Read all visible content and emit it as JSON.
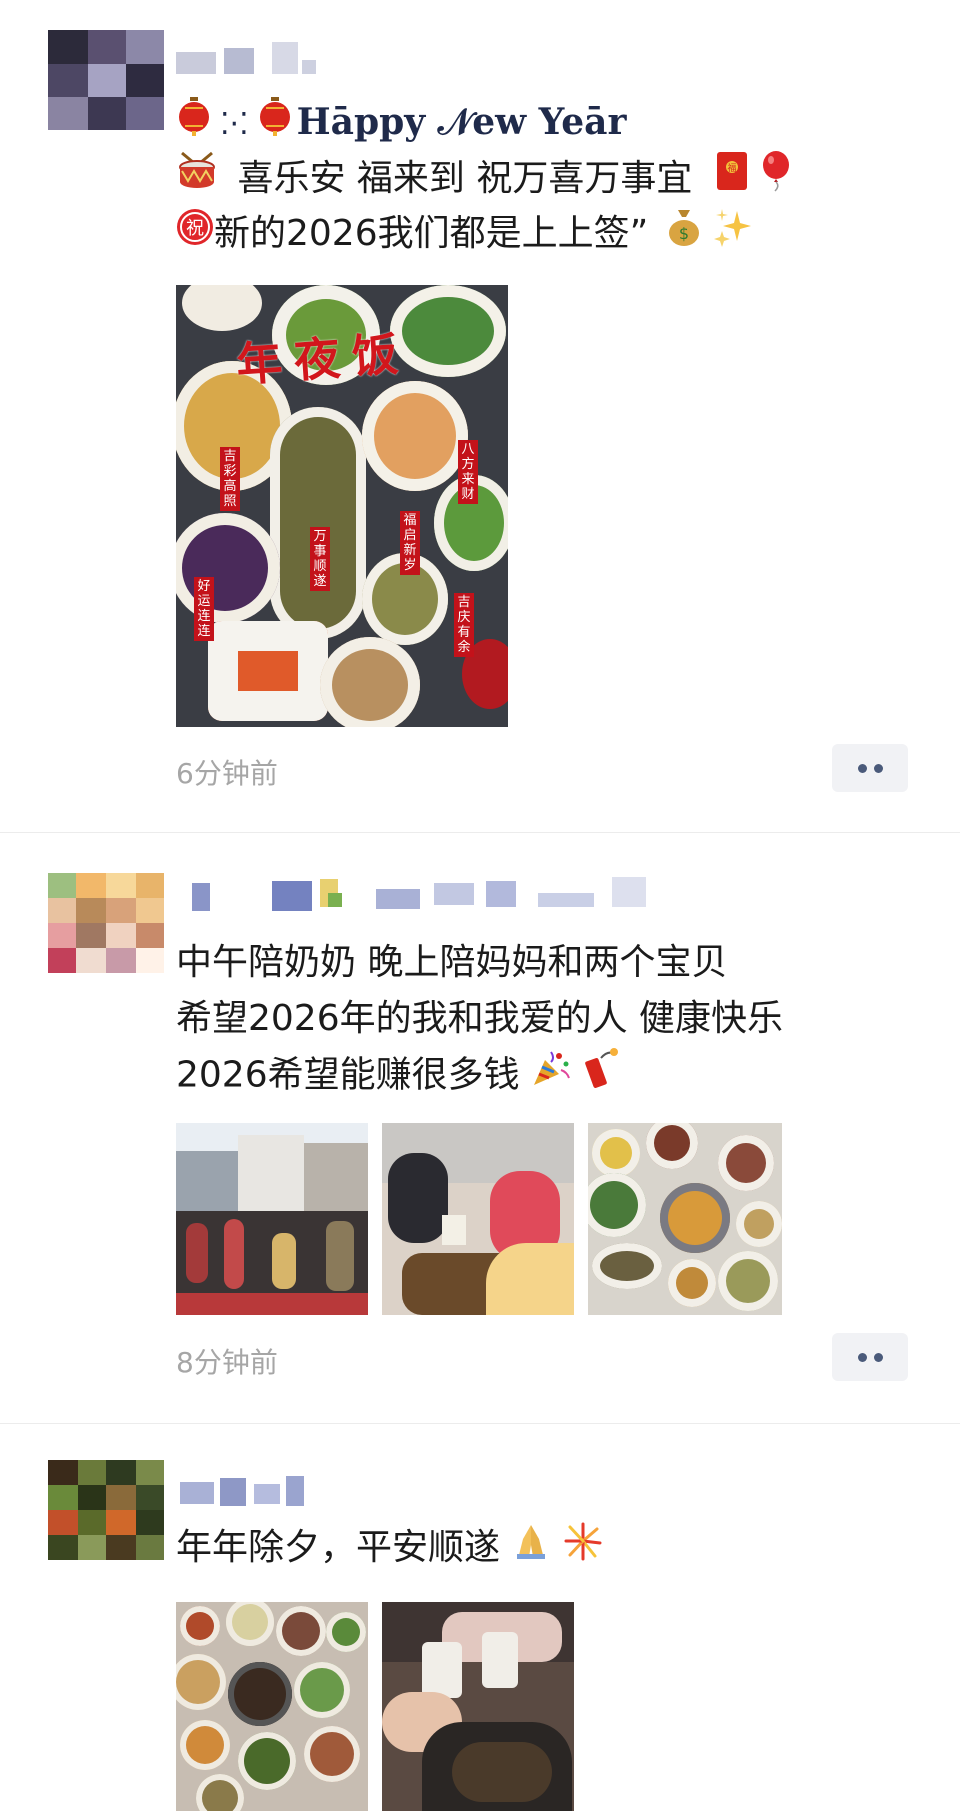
{
  "posts": [
    {
      "line1": {
        "text": "Hāppy 𝒩ew Yeār"
      },
      "line2": "喜乐安 福来到 祝万喜万事宜",
      "line3": "新的2026我们都是上上签”",
      "image_title": "年夜饭",
      "image_tags": [
        "吉彩高照",
        "八方来财",
        "福启新岁",
        "万事顺遂",
        "吉庆有余",
        "好运连连"
      ],
      "time": "6分钟前",
      "icons": [
        "lantern-icon",
        "drum-icon",
        "red-envelope-icon",
        "balloon-icon",
        "blessing-icon",
        "money-bag-icon",
        "sparkles-icon"
      ]
    },
    {
      "line1": "中午陪奶奶 晚上陪妈妈和两个宝贝",
      "line2": "希望2026年的我和我爱的人 健康快乐",
      "line3": "2026希望能赚很多钱",
      "time": "8分钟前",
      "icons": [
        "party-popper-icon",
        "firecracker-icon"
      ]
    },
    {
      "line1": "年年除夕，平安顺遂",
      "icons": [
        "praying-hands-icon",
        "fireworks-icon"
      ]
    }
  ],
  "colors": {
    "accent_blue": "#4a5a7a",
    "time_gray": "#a6a6a6",
    "festive_red": "#c3121a"
  }
}
